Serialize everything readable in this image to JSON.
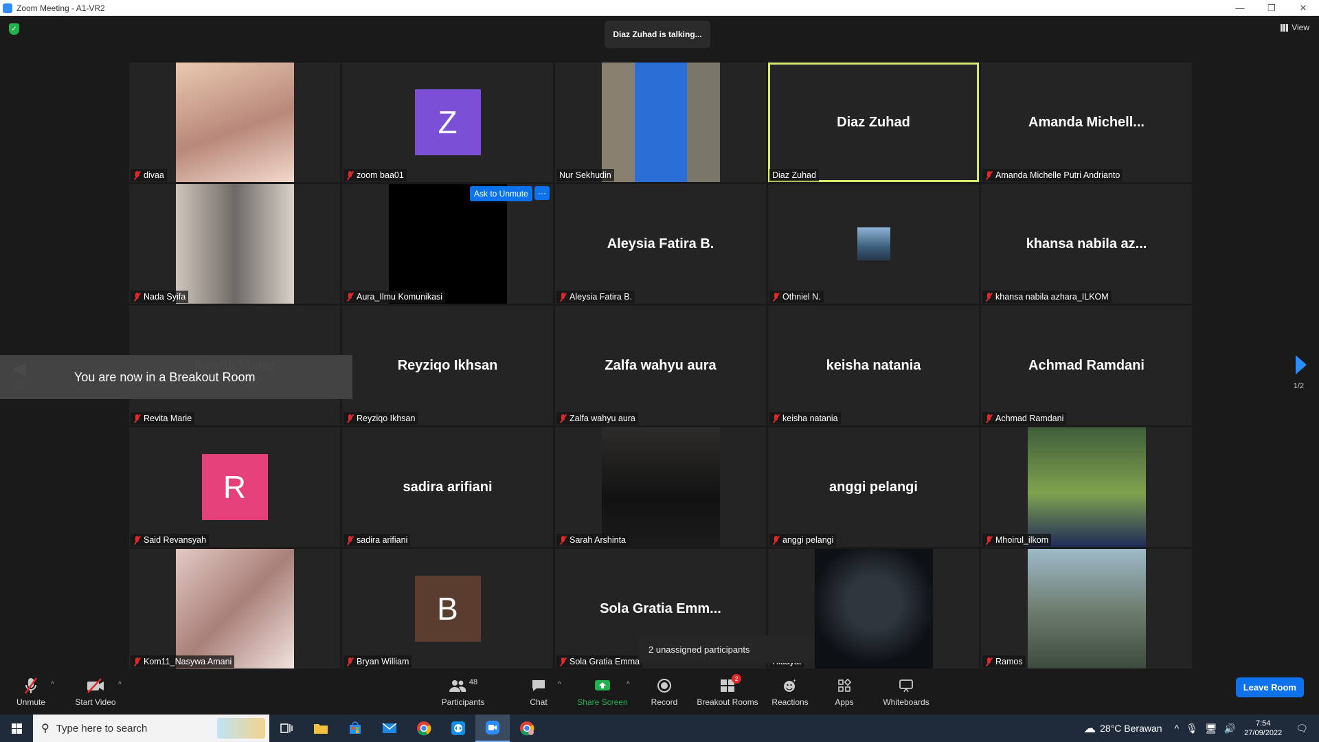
{
  "window": {
    "title": "Zoom Meeting - A1-VR2"
  },
  "meeting": {
    "talking_banner": "Diaz Zuhad is talking...",
    "view_label": "View",
    "breakout_toast": "You are now in a Breakout Room",
    "page_indicator": "1/2",
    "unassigned_label": "2 unassigned participants",
    "ask_to_unmute": "Ask to Unmute",
    "more_label": "···"
  },
  "tiles": [
    {
      "name": "divaa",
      "big": "",
      "avatar": "",
      "muted": true
    },
    {
      "name": "zoom baa01",
      "big": "",
      "avatar": "Z",
      "avatar_color": "#7b50d6",
      "muted": true
    },
    {
      "name": "Nur Sekhudin",
      "big": "",
      "avatar": "",
      "muted": false
    },
    {
      "name": "Diaz Zuhad",
      "big": "Diaz Zuhad",
      "avatar": "",
      "muted": false,
      "active": true
    },
    {
      "name": "Amanda Michelle Putri Andrianto",
      "big": "Amanda  Michell...",
      "avatar": "",
      "muted": true
    },
    {
      "name": "Nada Syifa",
      "big": "",
      "avatar": "",
      "muted": true
    },
    {
      "name": "Aura_Ilmu Komunikasi",
      "big": "",
      "avatar": "",
      "muted": true
    },
    {
      "name": "Aleysia Fatira B.",
      "big": "Aleysia Fatira B.",
      "avatar": "",
      "muted": true
    },
    {
      "name": "Othniel N.",
      "big": "",
      "avatar": "",
      "muted": true
    },
    {
      "name": "khansa nabila azhara_ILKOM",
      "big": "khansa nabila az...",
      "avatar": "",
      "muted": true
    },
    {
      "name": "Revita Marie",
      "big": "Revita Marie",
      "avatar": "",
      "muted": true
    },
    {
      "name": "Reyziqo Ikhsan",
      "big": "Reyziqo Ikhsan",
      "avatar": "",
      "muted": true
    },
    {
      "name": "Zalfa wahyu aura",
      "big": "Zalfa wahyu aura",
      "avatar": "",
      "muted": true
    },
    {
      "name": "keisha natania",
      "big": "keisha natania",
      "avatar": "",
      "muted": true
    },
    {
      "name": "Achmad Ramdani",
      "big": "Achmad Ramdani",
      "avatar": "",
      "muted": true
    },
    {
      "name": "Said Revansyah",
      "big": "",
      "avatar": "R",
      "avatar_color": "#e5407a",
      "muted": true
    },
    {
      "name": "sadira arifiani",
      "big": "sadira arifiani",
      "avatar": "",
      "muted": true
    },
    {
      "name": "Sarah Arshinta",
      "big": "",
      "avatar": "",
      "muted": true
    },
    {
      "name": "anggi pelangi",
      "big": "anggi pelangi",
      "avatar": "",
      "muted": true
    },
    {
      "name": "Mhoirul_ilkom",
      "big": "",
      "avatar": "",
      "muted": true
    },
    {
      "name": "Kom11_Nasywa Amani",
      "big": "",
      "avatar": "",
      "muted": true
    },
    {
      "name": "Bryan William",
      "big": "",
      "avatar": "B",
      "avatar_color": "#5a3d2e",
      "muted": true
    },
    {
      "name": "Sola Gratia Emma",
      "big": "Sola Gratia Emm...",
      "avatar": "",
      "muted": true
    },
    {
      "name": "Hidayat",
      "big": "",
      "avatar": "",
      "muted": false
    },
    {
      "name": "Ramos",
      "big": "",
      "avatar": "",
      "muted": true
    }
  ],
  "toolbar": {
    "unmute": "Unmute",
    "start_video": "Start Video",
    "participants": "Participants",
    "participants_count": "48",
    "chat": "Chat",
    "share_screen": "Share Screen",
    "record": "Record",
    "breakout_rooms": "Breakout Rooms",
    "breakout_badge": "2",
    "reactions": "Reactions",
    "apps": "Apps",
    "whiteboards": "Whiteboards",
    "leave_room": "Leave Room"
  },
  "taskbar": {
    "search_placeholder": "Type here to search",
    "weather": "28°C  Berawan",
    "time": "7:54",
    "date": "27/09/2022"
  },
  "colors": {
    "accent": "#0e72ed",
    "share_green": "#23b14d",
    "active_speaker": "#d8e86c",
    "muted_red": "#e02828"
  }
}
